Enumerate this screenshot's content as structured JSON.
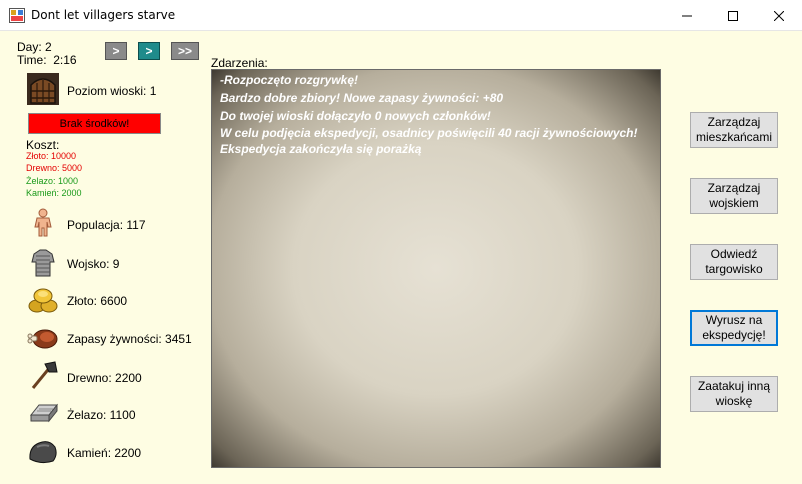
{
  "window": {
    "title": "Dont let villagers starve"
  },
  "status": {
    "day": "Day: 2",
    "time": "Time:  2:16"
  },
  "speed_buttons": [
    ">",
    ">",
    ">>"
  ],
  "village": {
    "level": "Poziom wioski: 1",
    "no_funds": "Brak środków!"
  },
  "cost": {
    "title": "Koszt:",
    "gold": "Złoto: 10000",
    "wood": "Drewno: 5000",
    "iron": "Żelazo: 1000",
    "stone": "Kamień: 2000"
  },
  "resources": {
    "population": "Populacja: 117",
    "army": "Wojsko: 9",
    "gold": "Złoto: 6600",
    "food": "Zapasy żywności: 3451",
    "wood": "Drewno: 2200",
    "iron": "Żelazo: 1100",
    "stone": "Kamień: 2200"
  },
  "events": {
    "label": "Zdarzenia:",
    "lines": [
      "-Rozpoczęto rozgrywkę!",
      "Bardzo dobre zbiory! Nowe zapasy żywności: +80",
      "Do twojej wioski dołączyło 0 nowych członków!",
      "W celu podjęcia ekspedycji, osadnicy poświęcili 40 racji żywnościowych!",
      "Ekspedycja zakończyła się porażką"
    ]
  },
  "actions": {
    "manage_residents": "Zarządzaj mieszkańcami",
    "manage_army": "Zarządzaj wojskiem",
    "visit_market": "Odwiedź targowisko",
    "expedition": "Wyrusz na ekspedycję!",
    "attack": "Zaatakuj inną wioskę"
  },
  "colors": {
    "background": "#fefde3",
    "no_funds": "#ff0000",
    "active_speed": "#1f8b8b",
    "cost_red": "#e40000",
    "cost_green": "#1a9a1a"
  }
}
